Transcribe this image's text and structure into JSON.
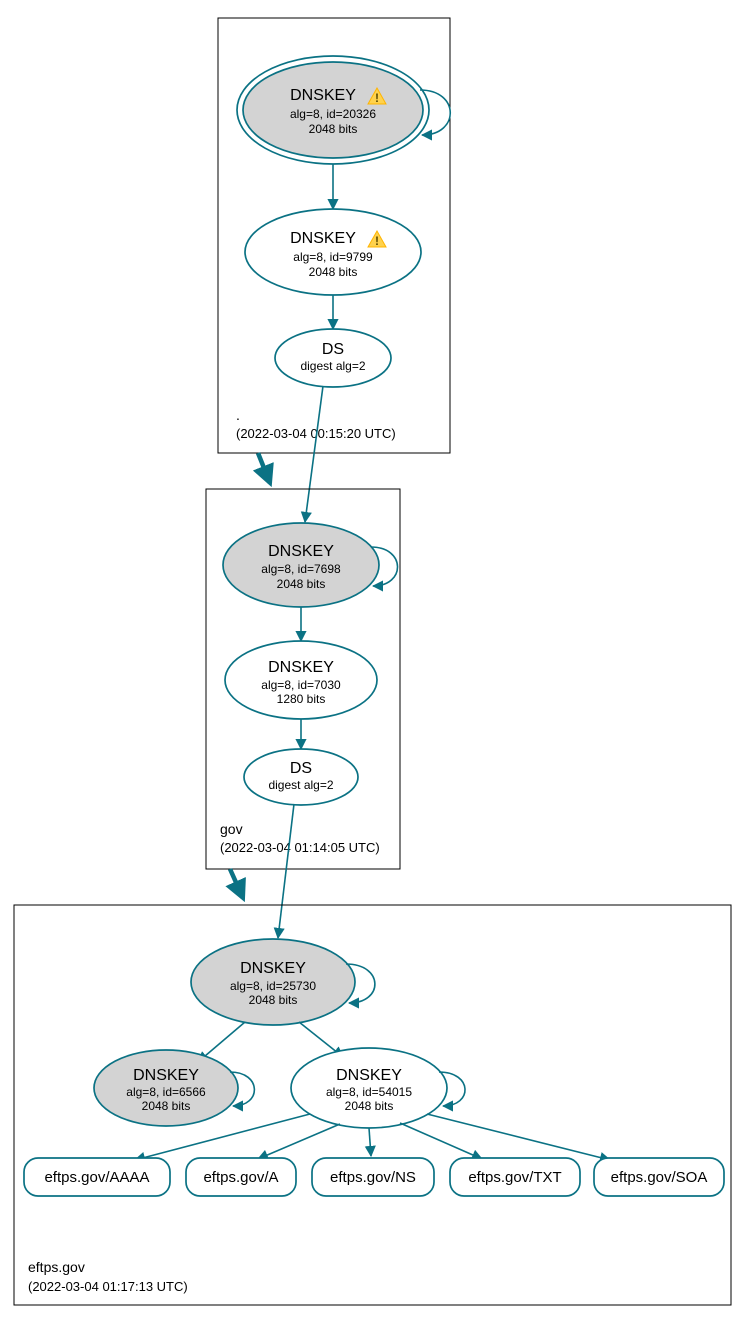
{
  "colors": {
    "stroke": "#0b7284",
    "grey_fill": "#d3d3d3"
  },
  "zones": {
    "root": {
      "label": ".",
      "timestamp": "(2022-03-04 00:15:20 UTC)"
    },
    "gov": {
      "label": "gov",
      "timestamp": "(2022-03-04 01:14:05 UTC)"
    },
    "eftps": {
      "label": "eftps.gov",
      "timestamp": "(2022-03-04 01:17:13 UTC)"
    }
  },
  "nodes": {
    "root_ksk": {
      "title": "DNSKEY",
      "line1": "alg=8, id=20326",
      "line2": "2048 bits",
      "warning": true
    },
    "root_zsk": {
      "title": "DNSKEY",
      "line1": "alg=8, id=9799",
      "line2": "2048 bits",
      "warning": true
    },
    "root_ds": {
      "title": "DS",
      "line1": "digest alg=2"
    },
    "gov_ksk": {
      "title": "DNSKEY",
      "line1": "alg=8, id=7698",
      "line2": "2048 bits"
    },
    "gov_zsk": {
      "title": "DNSKEY",
      "line1": "alg=8, id=7030",
      "line2": "1280 bits"
    },
    "gov_ds": {
      "title": "DS",
      "line1": "digest alg=2"
    },
    "eftps_ksk": {
      "title": "DNSKEY",
      "line1": "alg=8, id=25730",
      "line2": "2048 bits"
    },
    "eftps_key_6566": {
      "title": "DNSKEY",
      "line1": "alg=8, id=6566",
      "line2": "2048 bits"
    },
    "eftps_zsk": {
      "title": "DNSKEY",
      "line1": "alg=8, id=54015",
      "line2": "2048 bits"
    }
  },
  "rr": {
    "aaaa": "eftps.gov/AAAA",
    "a": "eftps.gov/A",
    "ns": "eftps.gov/NS",
    "txt": "eftps.gov/TXT",
    "soa": "eftps.gov/SOA"
  }
}
